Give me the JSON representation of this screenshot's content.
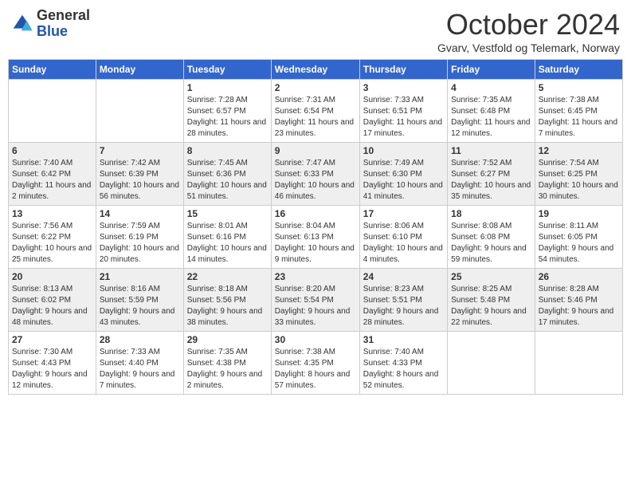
{
  "header": {
    "logo_general": "General",
    "logo_blue": "Blue",
    "month_title": "October 2024",
    "location": "Gvarv, Vestfold og Telemark, Norway"
  },
  "days_of_week": [
    "Sunday",
    "Monday",
    "Tuesday",
    "Wednesday",
    "Thursday",
    "Friday",
    "Saturday"
  ],
  "weeks": [
    [
      {
        "day": "",
        "sunrise": "",
        "sunset": "",
        "daylight": ""
      },
      {
        "day": "",
        "sunrise": "",
        "sunset": "",
        "daylight": ""
      },
      {
        "day": "1",
        "sunrise": "Sunrise: 7:28 AM",
        "sunset": "Sunset: 6:57 PM",
        "daylight": "Daylight: 11 hours and 28 minutes."
      },
      {
        "day": "2",
        "sunrise": "Sunrise: 7:31 AM",
        "sunset": "Sunset: 6:54 PM",
        "daylight": "Daylight: 11 hours and 23 minutes."
      },
      {
        "day": "3",
        "sunrise": "Sunrise: 7:33 AM",
        "sunset": "Sunset: 6:51 PM",
        "daylight": "Daylight: 11 hours and 17 minutes."
      },
      {
        "day": "4",
        "sunrise": "Sunrise: 7:35 AM",
        "sunset": "Sunset: 6:48 PM",
        "daylight": "Daylight: 11 hours and 12 minutes."
      },
      {
        "day": "5",
        "sunrise": "Sunrise: 7:38 AM",
        "sunset": "Sunset: 6:45 PM",
        "daylight": "Daylight: 11 hours and 7 minutes."
      }
    ],
    [
      {
        "day": "6",
        "sunrise": "Sunrise: 7:40 AM",
        "sunset": "Sunset: 6:42 PM",
        "daylight": "Daylight: 11 hours and 2 minutes."
      },
      {
        "day": "7",
        "sunrise": "Sunrise: 7:42 AM",
        "sunset": "Sunset: 6:39 PM",
        "daylight": "Daylight: 10 hours and 56 minutes."
      },
      {
        "day": "8",
        "sunrise": "Sunrise: 7:45 AM",
        "sunset": "Sunset: 6:36 PM",
        "daylight": "Daylight: 10 hours and 51 minutes."
      },
      {
        "day": "9",
        "sunrise": "Sunrise: 7:47 AM",
        "sunset": "Sunset: 6:33 PM",
        "daylight": "Daylight: 10 hours and 46 minutes."
      },
      {
        "day": "10",
        "sunrise": "Sunrise: 7:49 AM",
        "sunset": "Sunset: 6:30 PM",
        "daylight": "Daylight: 10 hours and 41 minutes."
      },
      {
        "day": "11",
        "sunrise": "Sunrise: 7:52 AM",
        "sunset": "Sunset: 6:27 PM",
        "daylight": "Daylight: 10 hours and 35 minutes."
      },
      {
        "day": "12",
        "sunrise": "Sunrise: 7:54 AM",
        "sunset": "Sunset: 6:25 PM",
        "daylight": "Daylight: 10 hours and 30 minutes."
      }
    ],
    [
      {
        "day": "13",
        "sunrise": "Sunrise: 7:56 AM",
        "sunset": "Sunset: 6:22 PM",
        "daylight": "Daylight: 10 hours and 25 minutes."
      },
      {
        "day": "14",
        "sunrise": "Sunrise: 7:59 AM",
        "sunset": "Sunset: 6:19 PM",
        "daylight": "Daylight: 10 hours and 20 minutes."
      },
      {
        "day": "15",
        "sunrise": "Sunrise: 8:01 AM",
        "sunset": "Sunset: 6:16 PM",
        "daylight": "Daylight: 10 hours and 14 minutes."
      },
      {
        "day": "16",
        "sunrise": "Sunrise: 8:04 AM",
        "sunset": "Sunset: 6:13 PM",
        "daylight": "Daylight: 10 hours and 9 minutes."
      },
      {
        "day": "17",
        "sunrise": "Sunrise: 8:06 AM",
        "sunset": "Sunset: 6:10 PM",
        "daylight": "Daylight: 10 hours and 4 minutes."
      },
      {
        "day": "18",
        "sunrise": "Sunrise: 8:08 AM",
        "sunset": "Sunset: 6:08 PM",
        "daylight": "Daylight: 9 hours and 59 minutes."
      },
      {
        "day": "19",
        "sunrise": "Sunrise: 8:11 AM",
        "sunset": "Sunset: 6:05 PM",
        "daylight": "Daylight: 9 hours and 54 minutes."
      }
    ],
    [
      {
        "day": "20",
        "sunrise": "Sunrise: 8:13 AM",
        "sunset": "Sunset: 6:02 PM",
        "daylight": "Daylight: 9 hours and 48 minutes."
      },
      {
        "day": "21",
        "sunrise": "Sunrise: 8:16 AM",
        "sunset": "Sunset: 5:59 PM",
        "daylight": "Daylight: 9 hours and 43 minutes."
      },
      {
        "day": "22",
        "sunrise": "Sunrise: 8:18 AM",
        "sunset": "Sunset: 5:56 PM",
        "daylight": "Daylight: 9 hours and 38 minutes."
      },
      {
        "day": "23",
        "sunrise": "Sunrise: 8:20 AM",
        "sunset": "Sunset: 5:54 PM",
        "daylight": "Daylight: 9 hours and 33 minutes."
      },
      {
        "day": "24",
        "sunrise": "Sunrise: 8:23 AM",
        "sunset": "Sunset: 5:51 PM",
        "daylight": "Daylight: 9 hours and 28 minutes."
      },
      {
        "day": "25",
        "sunrise": "Sunrise: 8:25 AM",
        "sunset": "Sunset: 5:48 PM",
        "daylight": "Daylight: 9 hours and 22 minutes."
      },
      {
        "day": "26",
        "sunrise": "Sunrise: 8:28 AM",
        "sunset": "Sunset: 5:46 PM",
        "daylight": "Daylight: 9 hours and 17 minutes."
      }
    ],
    [
      {
        "day": "27",
        "sunrise": "Sunrise: 7:30 AM",
        "sunset": "Sunset: 4:43 PM",
        "daylight": "Daylight: 9 hours and 12 minutes."
      },
      {
        "day": "28",
        "sunrise": "Sunrise: 7:33 AM",
        "sunset": "Sunset: 4:40 PM",
        "daylight": "Daylight: 9 hours and 7 minutes."
      },
      {
        "day": "29",
        "sunrise": "Sunrise: 7:35 AM",
        "sunset": "Sunset: 4:38 PM",
        "daylight": "Daylight: 9 hours and 2 minutes."
      },
      {
        "day": "30",
        "sunrise": "Sunrise: 7:38 AM",
        "sunset": "Sunset: 4:35 PM",
        "daylight": "Daylight: 8 hours and 57 minutes."
      },
      {
        "day": "31",
        "sunrise": "Sunrise: 7:40 AM",
        "sunset": "Sunset: 4:33 PM",
        "daylight": "Daylight: 8 hours and 52 minutes."
      },
      {
        "day": "",
        "sunrise": "",
        "sunset": "",
        "daylight": ""
      },
      {
        "day": "",
        "sunrise": "",
        "sunset": "",
        "daylight": ""
      }
    ]
  ]
}
